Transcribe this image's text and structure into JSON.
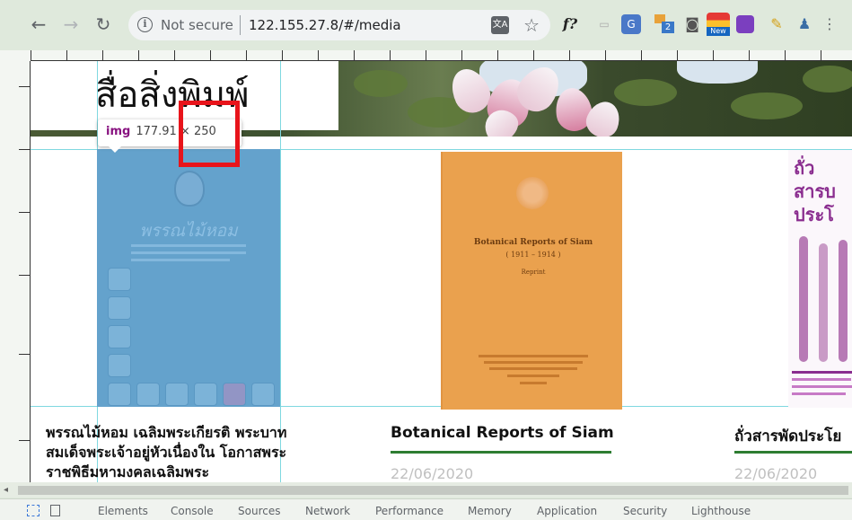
{
  "browser": {
    "security_label": "Not secure",
    "url": "122.155.27.8/#/media",
    "ext_f": "f?",
    "ext_badge": "2",
    "ext_new": "New"
  },
  "page": {
    "title": "สื่อสิ่งพิมพ์"
  },
  "tooltip": {
    "tag": "img",
    "dims": "177.91 × 250"
  },
  "covers": {
    "c1_title": "พรรณไม้หอม",
    "c2_title": "Botanical Reports of Siam",
    "c2_years": "( 1911 – 1914 )",
    "c2_sub": "Reprint",
    "c3_line1": "ถั่ว",
    "c3_line2": "สารบ",
    "c3_line3": "ประโ"
  },
  "items": [
    {
      "title": "พรรณไม้หอม เฉลิมพระเกียรติ พระบาทสมเด็จพระเจ้าอยู่หัวเนื่องใน โอกาสพระราชพิธีมหามงคลเฉลิมพระ",
      "date": ""
    },
    {
      "title": "Botanical Reports of Siam",
      "date": "22/06/2020"
    },
    {
      "title": "ถั่วสารพัดประโย",
      "date": "22/06/2020"
    }
  ],
  "devtools": {
    "tabs": [
      "Elements",
      "Console",
      "Sources",
      "Network",
      "Performance",
      "Memory",
      "Application",
      "Security",
      "Lighthouse"
    ]
  },
  "colors": {
    "highlight": "#e8141b",
    "guide": "#7fd8e0",
    "underline": "#2e7d32"
  }
}
